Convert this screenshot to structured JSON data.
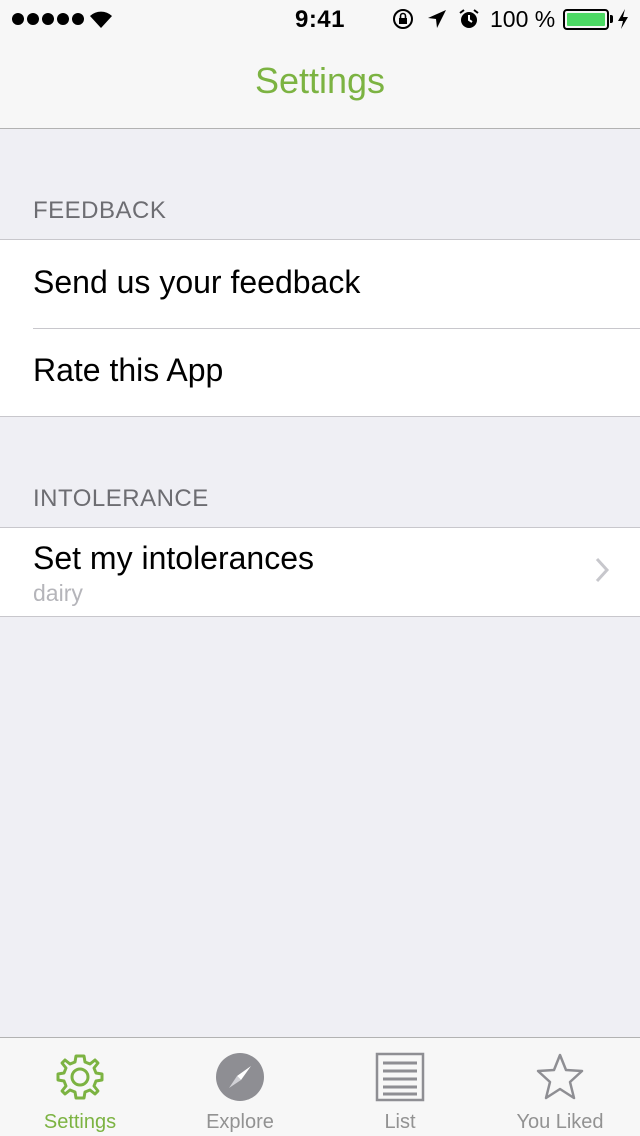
{
  "status_bar": {
    "time": "9:41",
    "battery_percent": "100 %",
    "battery_level": 1.0
  },
  "nav": {
    "title": "Settings"
  },
  "sections": {
    "feedback": {
      "header": "FEEDBACK",
      "rows": [
        {
          "label": "Send us your feedback"
        },
        {
          "label": "Rate this App"
        }
      ]
    },
    "intolerance": {
      "header": "INTOLERANCE",
      "rows": [
        {
          "label": "Set my intolerances",
          "detail": "dairy"
        }
      ]
    }
  },
  "tabbar": {
    "items": [
      {
        "label": "Settings",
        "icon": "gear-icon",
        "active": true
      },
      {
        "label": "Explore",
        "icon": "compass-icon",
        "active": false
      },
      {
        "label": "List",
        "icon": "list-icon",
        "active": false
      },
      {
        "label": "You Liked",
        "icon": "star-icon",
        "active": false
      }
    ]
  },
  "colors": {
    "accent": "#7cb342",
    "background": "#efeff4",
    "battery": "#4cd964",
    "inactive_tab": "#929292"
  }
}
